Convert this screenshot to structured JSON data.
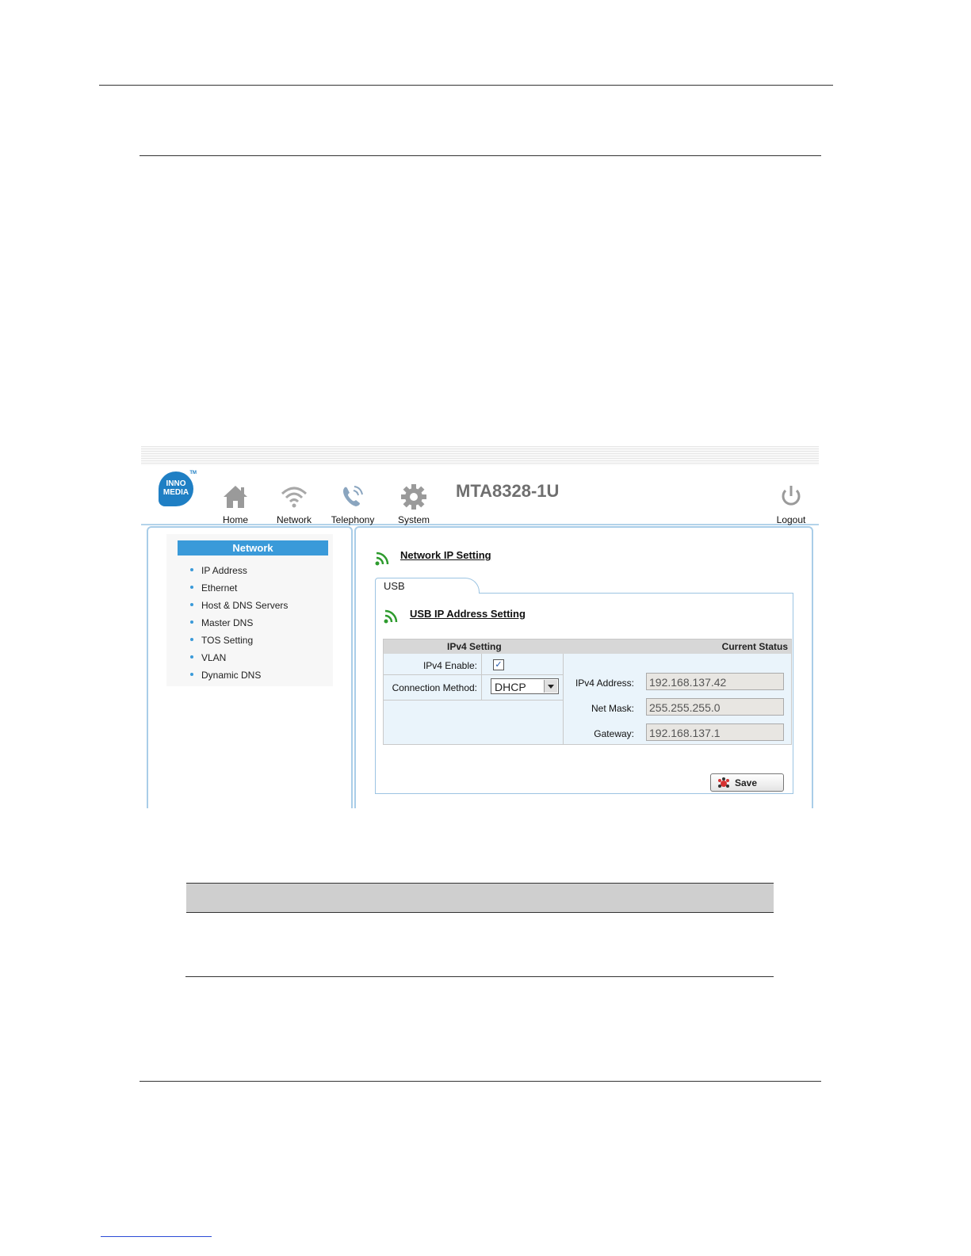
{
  "app": {
    "model": "MTA8328-1U",
    "logo_text": "INNO MEDIA",
    "logo_tm": "TM"
  },
  "nav": {
    "home": "Home",
    "network": "Network",
    "telephony": "Telephony",
    "system": "System",
    "logout": "Logout"
  },
  "sidebar": {
    "title": "Network",
    "items": [
      {
        "label": "IP Address"
      },
      {
        "label": "Ethernet"
      },
      {
        "label": "Host & DNS Servers"
      },
      {
        "label": "Master DNS"
      },
      {
        "label": "TOS Setting"
      },
      {
        "label": "VLAN"
      },
      {
        "label": "Dynamic DNS"
      }
    ]
  },
  "main": {
    "title": "Network IP Setting",
    "tab": "USB",
    "section_title": "USB IP Address Setting",
    "table": {
      "col_ipv4": "IPv4 Setting",
      "col_status": "Current Status",
      "ipv4_enable_label": "IPv4 Enable:",
      "ipv4_enable_checked": true,
      "connection_method_label": "Connection Method:",
      "connection_method_value": "DHCP",
      "ipv4_address_label": "IPv4 Address:",
      "ipv4_address_value": "192.168.137.42",
      "net_mask_label": "Net Mask:",
      "net_mask_value": "255.255.255.0",
      "gateway_label": "Gateway:",
      "gateway_value": "192.168.137.1"
    },
    "save_label": "Save"
  },
  "colors": {
    "accent": "#3a9ad9",
    "border": "#a9cde8",
    "rss": "#2e9b2e",
    "logo": "#1f7fc4"
  },
  "icons": {
    "home": "home-icon",
    "network": "wifi-icon",
    "telephony": "phone-icon",
    "system": "gear-icon",
    "logout": "power-icon",
    "section": "rss-icon",
    "save": "save-icon"
  }
}
